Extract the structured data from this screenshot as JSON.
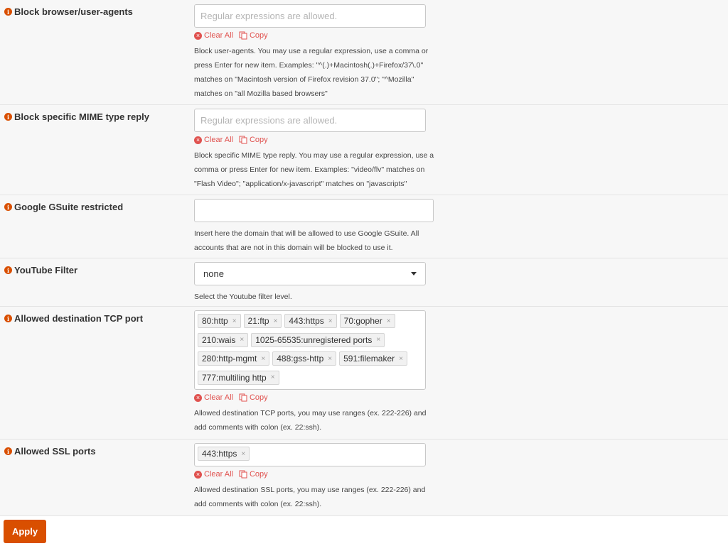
{
  "fields": {
    "block_ua": {
      "label": "Block browser/user-agents",
      "placeholder": "Regular expressions are allowed.",
      "clear_all": "Clear All",
      "copy": "Copy",
      "help": "Block user-agents. You may use a regular expression, use a comma or press Enter for new item. Examples: \"^(.)+Macintosh(.)+Firefox/37\\.0\" matches on \"Macintosh version of Firefox revision 37.0\"; \"^Mozilla\" matches on \"all Mozilla based browsers\""
    },
    "block_mime": {
      "label": "Block specific MIME type reply",
      "placeholder": "Regular expressions are allowed.",
      "clear_all": "Clear All",
      "copy": "Copy",
      "help": "Block specific MIME type reply. You may use a regular expression, use a comma or press Enter for new item. Examples: \"video/flv\" matches on \"Flash Video\"; \"application/x-javascript\" matches on \"javascripts\""
    },
    "gsuite": {
      "label": "Google GSuite restricted",
      "value": "",
      "help": "Insert here the domain that will be allowed to use Google GSuite. All accounts that are not in this domain will be blocked to use it."
    },
    "youtube": {
      "label": "YouTube Filter",
      "selected": "none",
      "help": "Select the Youtube filter level."
    },
    "tcp_ports": {
      "label": "Allowed destination TCP port",
      "tags": [
        "80:http",
        "21:ftp",
        "443:https",
        "70:gopher",
        "210:wais",
        "1025-65535:unregistered ports",
        "280:http-mgmt",
        "488:gss-http",
        "591:filemaker",
        "777:multiling http"
      ],
      "clear_all": "Clear All",
      "copy": "Copy",
      "help": "Allowed destination TCP ports, you may use ranges (ex. 222-226) and add comments with colon (ex. 22:ssh)."
    },
    "ssl_ports": {
      "label": "Allowed SSL ports",
      "tags": [
        "443:https"
      ],
      "clear_all": "Clear All",
      "copy": "Copy",
      "help": "Allowed destination SSL ports, you may use ranges (ex. 222-226) and add comments with colon (ex. 22:ssh)."
    }
  },
  "icons": {
    "info": "info-icon",
    "clear": "x-circle-icon",
    "copy": "copy-icon",
    "caret": "caret-down-icon"
  },
  "colors": {
    "accent": "#d94f00",
    "link_red": "#e0524f",
    "row_bg": "#f7f7f7"
  },
  "apply_label": "Apply"
}
